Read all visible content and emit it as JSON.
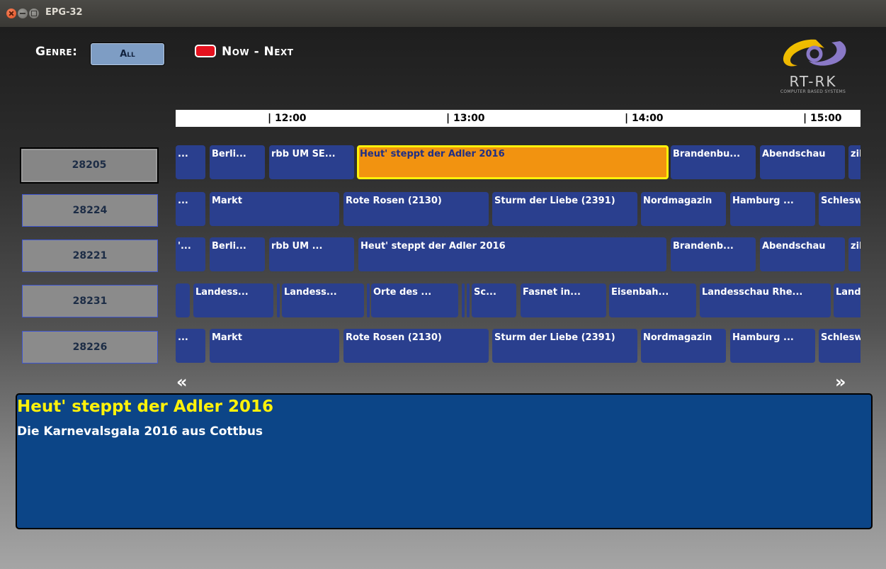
{
  "window": {
    "title": "EPG-32"
  },
  "header": {
    "genre_label": "Genre:",
    "genre_value": "All",
    "now_next_label": "Now - Next",
    "key_color": "#e5111e"
  },
  "logo": {
    "name": "RT-RK",
    "tagline": "COMPUTER BASED SYSTEMS",
    "icon": "rt-rk-logo"
  },
  "timeline": {
    "ticks": [
      "| 12:00",
      "| 13:00",
      "| 14:00",
      "| 15:00"
    ]
  },
  "channels": [
    {
      "id": "28205",
      "selected": true,
      "programs": [
        {
          "title": "..."
        },
        {
          "title": "Berli..."
        },
        {
          "title": "rbb UM SE..."
        },
        {
          "title": "Heut' steppt der Adler 2016",
          "selected": true
        },
        {
          "title": "Brandenbu..."
        },
        {
          "title": "Abendschau"
        },
        {
          "title": "zil"
        }
      ]
    },
    {
      "id": "28224",
      "selected": false,
      "programs": [
        {
          "title": "..."
        },
        {
          "title": "Markt"
        },
        {
          "title": "Rote Rosen (2130)"
        },
        {
          "title": "Sturm der Liebe (2391)"
        },
        {
          "title": "Nordmagazin"
        },
        {
          "title": "Hamburg ..."
        },
        {
          "title": "Schlesw"
        }
      ]
    },
    {
      "id": "28221",
      "selected": false,
      "programs": [
        {
          "title": "'..."
        },
        {
          "title": "Berli..."
        },
        {
          "title": "rbb UM ..."
        },
        {
          "title": "Heut' steppt der Adler 2016"
        },
        {
          "title": "Brandenb..."
        },
        {
          "title": "Abendschau"
        },
        {
          "title": "zil"
        }
      ]
    },
    {
      "id": "28231",
      "selected": false,
      "programs": [
        {
          "title": ""
        },
        {
          "title": "Landess..."
        },
        {
          "title": ""
        },
        {
          "title": "Landess..."
        },
        {
          "title": ""
        },
        {
          "title": "Orte des ..."
        },
        {
          "title": ""
        },
        {
          "title": ""
        },
        {
          "title": "Sc..."
        },
        {
          "title": "Fasnet in..."
        },
        {
          "title": "Eisenbah..."
        },
        {
          "title": "Landesschau Rhe..."
        },
        {
          "title": "Land"
        }
      ]
    },
    {
      "id": "28226",
      "selected": false,
      "programs": [
        {
          "title": "..."
        },
        {
          "title": "Markt"
        },
        {
          "title": "Rote Rosen (2130)"
        },
        {
          "title": "Sturm der Liebe (2391)"
        },
        {
          "title": "Nordmagazin"
        },
        {
          "title": "Hamburg ..."
        },
        {
          "title": "Schlesw"
        }
      ]
    }
  ],
  "navigation": {
    "prev": "«",
    "next": "»"
  },
  "details": {
    "title": "Heut' steppt der Adler 2016",
    "description": "Die Karnevalsgala 2016 aus Cottbus"
  },
  "colors": {
    "program_block": "#2a3f8e",
    "selected_block": "#f29310",
    "selected_border": "#fff20a",
    "info_panel": "#0c4587",
    "info_title": "#fff20a"
  }
}
